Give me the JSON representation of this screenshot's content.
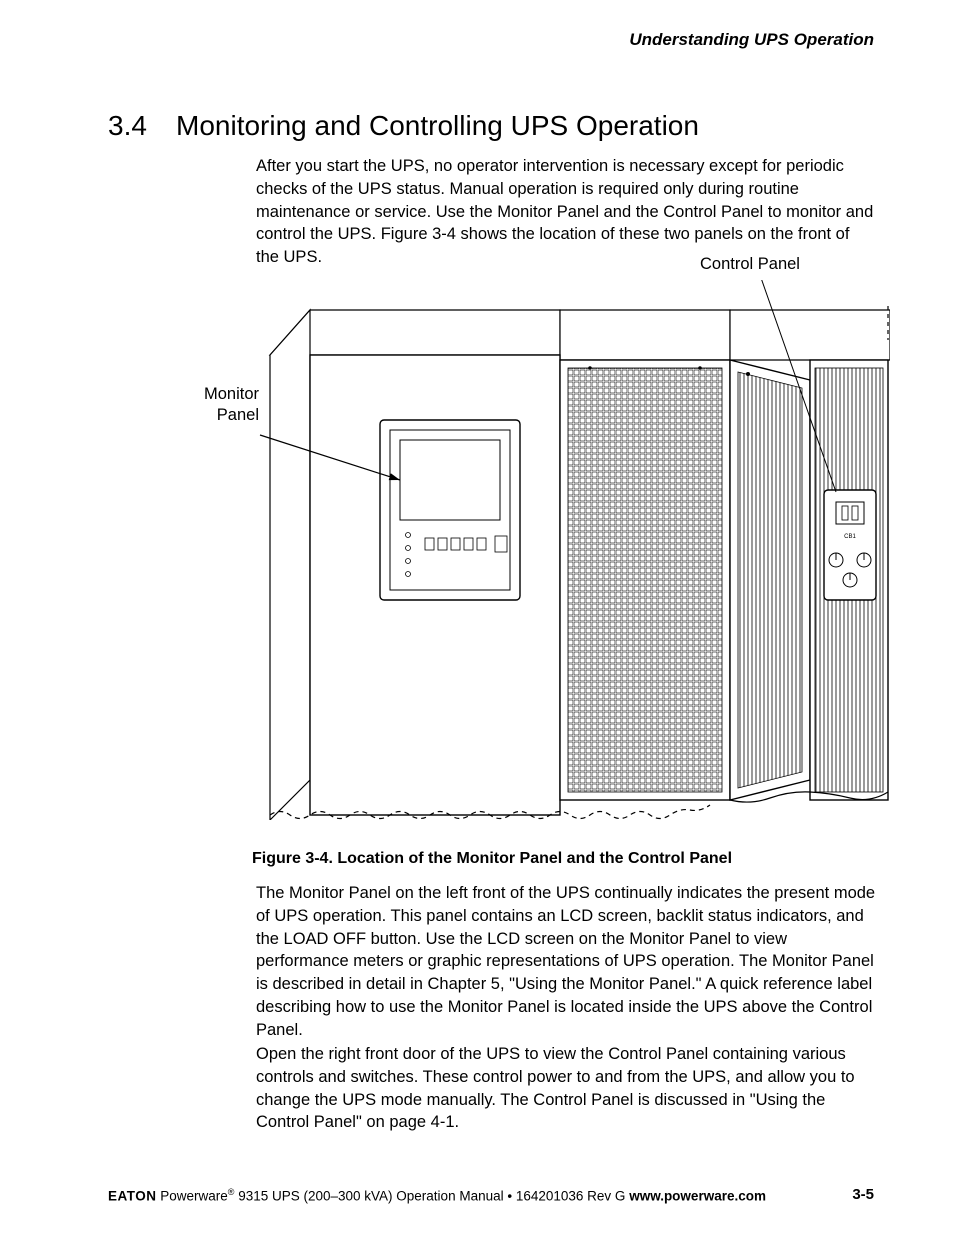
{
  "header": {
    "running_head": "Understanding UPS Operation"
  },
  "section": {
    "number": "3.4",
    "title": "Monitoring and Controlling UPS Operation"
  },
  "body": {
    "intro": "After you start the UPS, no operator intervention is necessary except for periodic checks of the UPS status. Manual operation is required only during routine maintenance or service. Use the Monitor Panel and the Control Panel to monitor and control the UPS. Figure 3-4 shows the location of these two panels on the front of the UPS.",
    "para2": "The Monitor Panel on the left front of the UPS continually indicates the present mode of UPS operation. This panel contains an LCD screen, backlit status indicators, and the LOAD OFF button. Use the LCD screen on the Monitor Panel to view performance meters or graphic representations of UPS operation. The Monitor Panel is described in detail in Chapter 5, \"Using the Monitor Panel.\" A quick reference label describing how to use the Monitor Panel is located inside the UPS above the Control Panel.",
    "para3": "Open the right front door of the UPS to view the Control Panel containing various controls and switches. These control power to and from the UPS, and allow you to change the UPS mode manually. The Control Panel is discussed in \"Using the Control Panel\" on page 4-1."
  },
  "figure": {
    "callout_control_panel": "Control Panel",
    "callout_monitor_panel_l1": "Monitor",
    "callout_monitor_panel_l2": "Panel",
    "caption": "Figure 3-4. Location of the Monitor Panel and the Control Panel",
    "cp_label_cb1": "CB1"
  },
  "footer": {
    "brand": "EATON",
    "product_before_reg": " Powerware",
    "reg_mark": "®",
    "product_after_reg": " 9315 UPS (200–300 kVA) Operation Manual",
    "sep": "   •   ",
    "docnum": "164201036 Rev G ",
    "url": "www.powerware.com",
    "page_num": "3-5"
  }
}
